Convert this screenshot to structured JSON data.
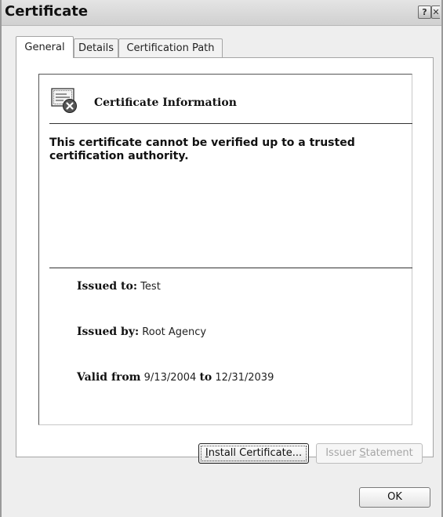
{
  "window": {
    "title": "Certificate",
    "help_glyph": "?",
    "close_glyph": "✕"
  },
  "tabs": [
    {
      "label": "General",
      "active": true
    },
    {
      "label": "Details",
      "active": false
    },
    {
      "label": "Certification Path",
      "active": false
    }
  ],
  "general": {
    "heading": "Certificate Information",
    "icon": "certificate-error-icon",
    "warning": "This certificate cannot be verified up to a trusted certification authority.",
    "issued_to_label": "Issued to:",
    "issued_to_value": "Test",
    "issued_by_label": "Issued by:",
    "issued_by_value": "Root Agency",
    "valid_from_label": "Valid from",
    "valid_from_value": "9/13/2004",
    "valid_to_label": "to",
    "valid_to_value": "12/31/2039"
  },
  "buttons": {
    "install_accel": "I",
    "install_rest": "nstall Certificate...",
    "issuer_pre": "Issuer ",
    "issuer_accel": "S",
    "issuer_post": "tatement",
    "ok": "OK"
  },
  "colors": {
    "window_bg": "#eeeeee",
    "panel_bg": "#ffffff",
    "disabled_text": "#a6a6a6"
  }
}
